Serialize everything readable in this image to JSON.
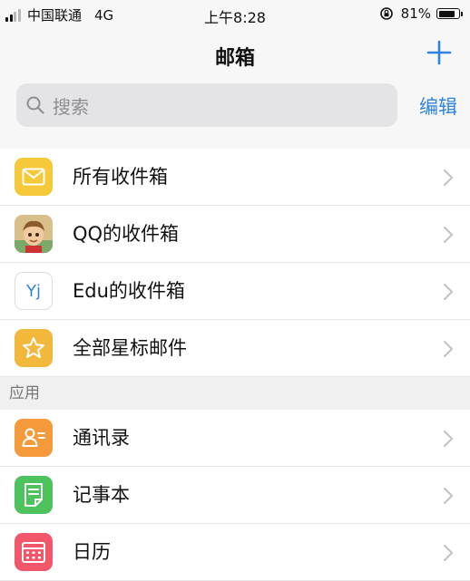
{
  "status_bar": {
    "carrier": "中国联通",
    "network": "4G",
    "time": "上午8:28",
    "battery": "81%",
    "battery_level": 0.81
  },
  "header": {
    "title": "邮箱",
    "add_icon": "plus-icon",
    "edit_label": "编辑"
  },
  "search": {
    "placeholder": "搜索",
    "icon": "search-icon"
  },
  "mailboxes": [
    {
      "label": "所有收件箱",
      "icon": "envelope-icon",
      "color": "#f5c93a"
    },
    {
      "label": "QQ的收件箱",
      "icon": "avatar-icon",
      "color": "#e8c07a"
    },
    {
      "label": "Edu的收件箱",
      "icon": "yj-logo-icon",
      "icon_text": "Yj",
      "color": "#ffffff"
    },
    {
      "label": "全部星标邮件",
      "icon": "star-icon",
      "color": "#f2b83c"
    }
  ],
  "apps_section": {
    "title": "应用",
    "items": [
      {
        "label": "通讯录",
        "icon": "contacts-icon",
        "color": "#f59a3a"
      },
      {
        "label": "记事本",
        "icon": "notepad-icon",
        "color": "#4cc35c"
      },
      {
        "label": "日历",
        "icon": "calendar-icon",
        "color": "#f2566a"
      }
    ]
  },
  "colors": {
    "accent": "#2f84e0",
    "header_bg": "#f7f7f7",
    "section_bg": "#f0f0f0"
  }
}
